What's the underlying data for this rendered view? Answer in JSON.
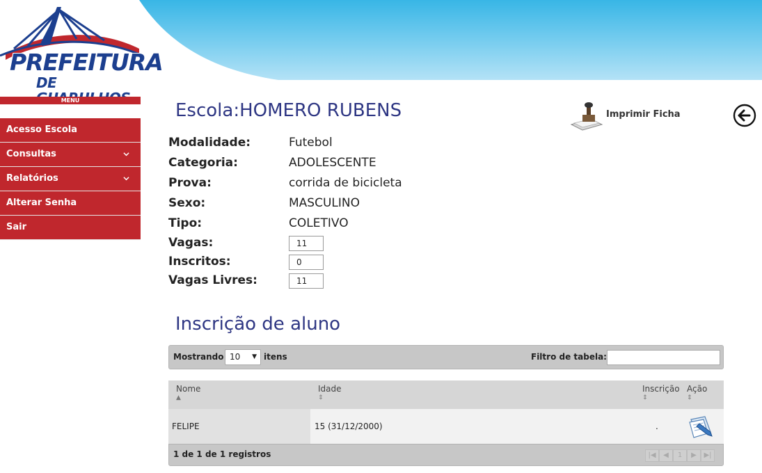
{
  "logo": {
    "line1": "PREFEITURA",
    "line2": "DE GUARULHOS"
  },
  "menu_label": "MENU",
  "sidebar": {
    "items": [
      {
        "label": "Acesso Escola",
        "has_submenu": false
      },
      {
        "label": "Consultas",
        "has_submenu": true
      },
      {
        "label": "Relatórios",
        "has_submenu": true
      },
      {
        "label": "Alterar Senha",
        "has_submenu": false
      },
      {
        "label": "Sair",
        "has_submenu": false
      }
    ]
  },
  "main": {
    "school_title": "Escola:HOMERO RUBENS",
    "print_label": "Imprimir Ficha",
    "print_icon": "stamp-print-icon",
    "back_icon": "back-arrow-icon",
    "info": {
      "modalidade_label": "Modalidade:",
      "modalidade_value": "Futebol",
      "categoria_label": "Categoria:",
      "categoria_value": "ADOLESCENTE",
      "prova_label": "Prova:",
      "prova_value": "corrida de bicicleta",
      "sexo_label": "Sexo:",
      "sexo_value": "MASCULINO",
      "tipo_label": "Tipo:",
      "tipo_value": "COLETIVO",
      "vagas_label": "Vagas:",
      "vagas_value": "11",
      "inscritos_label": "Inscritos:",
      "inscritos_value": "0",
      "livres_label": "Vagas Livres:",
      "livres_value": "11"
    },
    "section_title": "Inscrição de aluno"
  },
  "table": {
    "show_label": "Mostrando",
    "page_size": "10",
    "items_label": "itens",
    "filter_label": "Filtro de tabela:",
    "filter_value": "",
    "columns": [
      "Nome",
      "Idade",
      "Inscrição",
      "Ação"
    ],
    "rows": [
      {
        "nome": "FELIPE",
        "idade": "15 (31/12/2000)",
        "inscricao": ".",
        "acao_icon": "edit-document-icon"
      }
    ],
    "footer_info": "1 de 1 de 1 registros",
    "pager": {
      "current_page": "1"
    }
  },
  "colors": {
    "sidebar_red": "#c0272d",
    "title_blue": "#2e3683",
    "header_blue": "#38b6e6"
  }
}
